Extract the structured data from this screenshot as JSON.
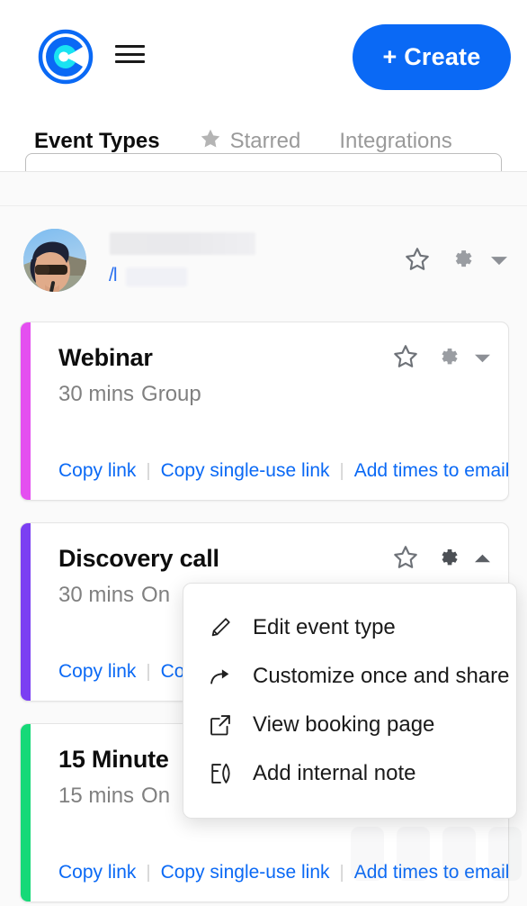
{
  "header": {
    "logo_name": "calendly-logo",
    "logo_outer_color": "#0a69f5",
    "logo_inner_color": "#00d4ef",
    "menu_icon": "hamburger-icon",
    "create_button_label": "+ Create",
    "create_button_color": "#0a69f5"
  },
  "tabs": [
    {
      "label": "Event Types",
      "icon": null,
      "active": true
    },
    {
      "label": "Starred",
      "icon": "star-icon",
      "active": false
    },
    {
      "label": "Integrations",
      "icon": null,
      "active": false
    }
  ],
  "profile": {
    "avatar": "user-avatar-photo",
    "display_name": "",
    "url_prefix": "/l",
    "username": "",
    "star_icon": "star-outline-icon",
    "gear_icon": "gear-icon",
    "chevron_icon": "chevron-down-icon"
  },
  "event_cards": [
    {
      "title": "Webinar",
      "duration": "30 mins",
      "type": "Group",
      "accent_color": "#e44ff0",
      "menu_open": false,
      "chevron": "chevron-down-icon",
      "links": [
        "Copy link",
        "Copy single-use link",
        "Add times to email"
      ]
    },
    {
      "title": "Discovery call",
      "duration": "30 mins",
      "type": "On",
      "accent_color": "#7b3ff2",
      "menu_open": true,
      "chevron": "chevron-up-icon",
      "links": [
        "Copy link",
        "Co",
        ""
      ]
    },
    {
      "title": "15 Minute",
      "duration": "15 mins",
      "type": "On",
      "accent_color": "#16d978",
      "menu_open": false,
      "chevron": "chevron-down-icon",
      "links": [
        "Copy link",
        "Copy single-use link",
        "Add times to email"
      ]
    }
  ],
  "dropdown_menu": {
    "items": [
      {
        "label": "Edit event type",
        "icon": "pencil-icon"
      },
      {
        "label": "Customize once and share",
        "icon": "share-arrow-icon"
      },
      {
        "label": "View booking page",
        "icon": "external-link-icon"
      },
      {
        "label": "Add internal note",
        "icon": "note-pen-icon"
      }
    ]
  },
  "colors": {
    "accent_blue": "#0a69f5",
    "link_blue": "#0a69f5",
    "text_dark": "#0d0d0d",
    "text_muted": "#808080",
    "background": "#fafafa"
  }
}
